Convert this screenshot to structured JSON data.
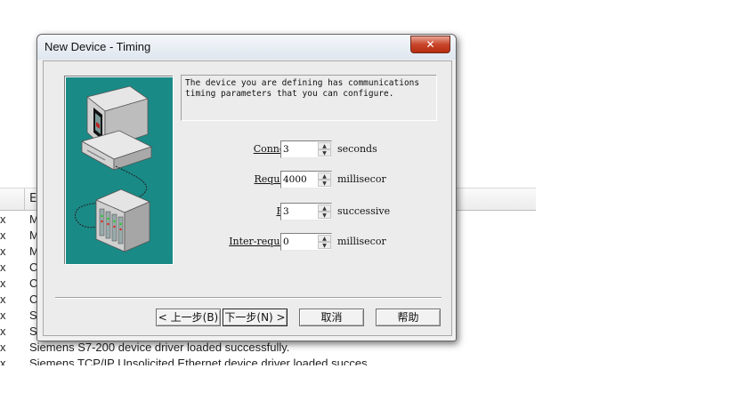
{
  "background": {
    "header_col2": "E",
    "rows": [
      {
        "x": "x",
        "msg": "M"
      },
      {
        "x": "x",
        "msg": "M"
      },
      {
        "x": "x",
        "msg": "M"
      },
      {
        "x": "x",
        "msg": "C"
      },
      {
        "x": "x",
        "msg": "C"
      },
      {
        "x": "x",
        "msg": "C"
      },
      {
        "x": "x",
        "msg": "S"
      },
      {
        "x": "x",
        "msg": "S"
      },
      {
        "x": "x",
        "msg": "Siemens S7-200 device driver loaded successfully."
      },
      {
        "x": "x",
        "msg": "Siemens TCP/IP Unsolicited Ethernet device driver loaded succes"
      }
    ]
  },
  "dialog": {
    "title": "New Device - Timing",
    "close_label": "✕",
    "info_text": "The device you are defining has communications\ntiming parameters that you can configure.",
    "fields": {
      "connect": {
        "label": "Connect",
        "value": "3",
        "unit": "seconds"
      },
      "request": {
        "label": "Request",
        "value": "4000",
        "unit": "millisecor"
      },
      "fail": {
        "label": "Fail",
        "value": "3",
        "unit": "successive"
      },
      "inter_request": {
        "label": "Inter-request",
        "value": "0",
        "unit": "millisecor"
      }
    },
    "buttons": {
      "back": "< 上一步(B)",
      "next": "下一步(N) >",
      "cancel": "取消",
      "help": "帮助"
    }
  }
}
